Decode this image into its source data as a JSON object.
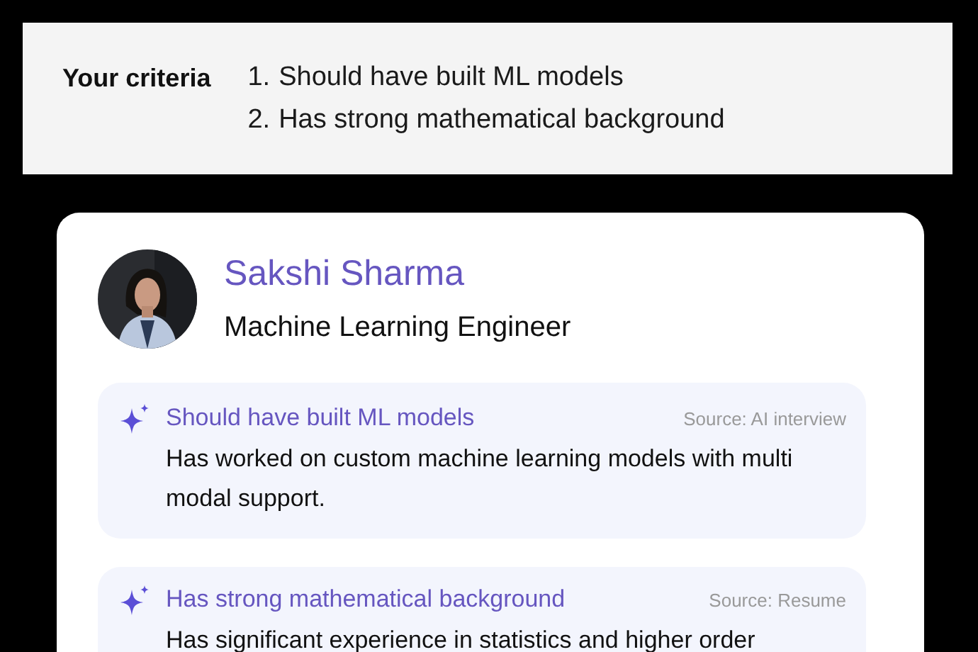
{
  "criteria": {
    "label": "Your criteria",
    "items": [
      {
        "number": "1.",
        "text": "Should have built ML models"
      },
      {
        "number": "2.",
        "text": "Has strong mathematical background"
      }
    ]
  },
  "candidate": {
    "name": "Sakshi Sharma",
    "role": "Machine Learning Engineer"
  },
  "evidence": [
    {
      "criterion": "Should have built ML models",
      "source": "Source: AI interview",
      "text": "Has worked on custom machine learning models with multi modal support."
    },
    {
      "criterion": "Has strong mathematical background",
      "source": "Source: Resume",
      "text": "Has significant experience in statistics and higher order"
    }
  ]
}
